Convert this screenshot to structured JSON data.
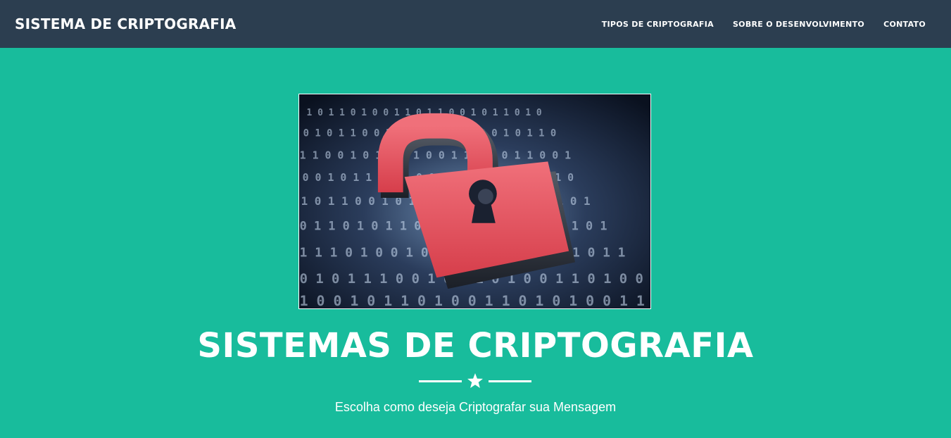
{
  "navbar": {
    "brand": "SISTEMA DE CRIPTOGRAFIA",
    "links": [
      {
        "label": "TIPOS DE CRIPTOGRAFIA"
      },
      {
        "label": "SOBRE O DESENVOLVIMENTO"
      },
      {
        "label": "CONTATO"
      }
    ]
  },
  "masthead": {
    "image": {
      "icon": "padlock-binary-image"
    },
    "title": "SISTEMAS DE CRIPTOGRAFIA",
    "divider_icon": "star-icon",
    "subtitle": "Escolha como deseja Criptografar sua Mensagem"
  },
  "colors": {
    "navbar_bg": "#2c3e50",
    "page_bg": "#18bc9c",
    "text": "#ffffff",
    "lock_red": "#e8505b"
  }
}
